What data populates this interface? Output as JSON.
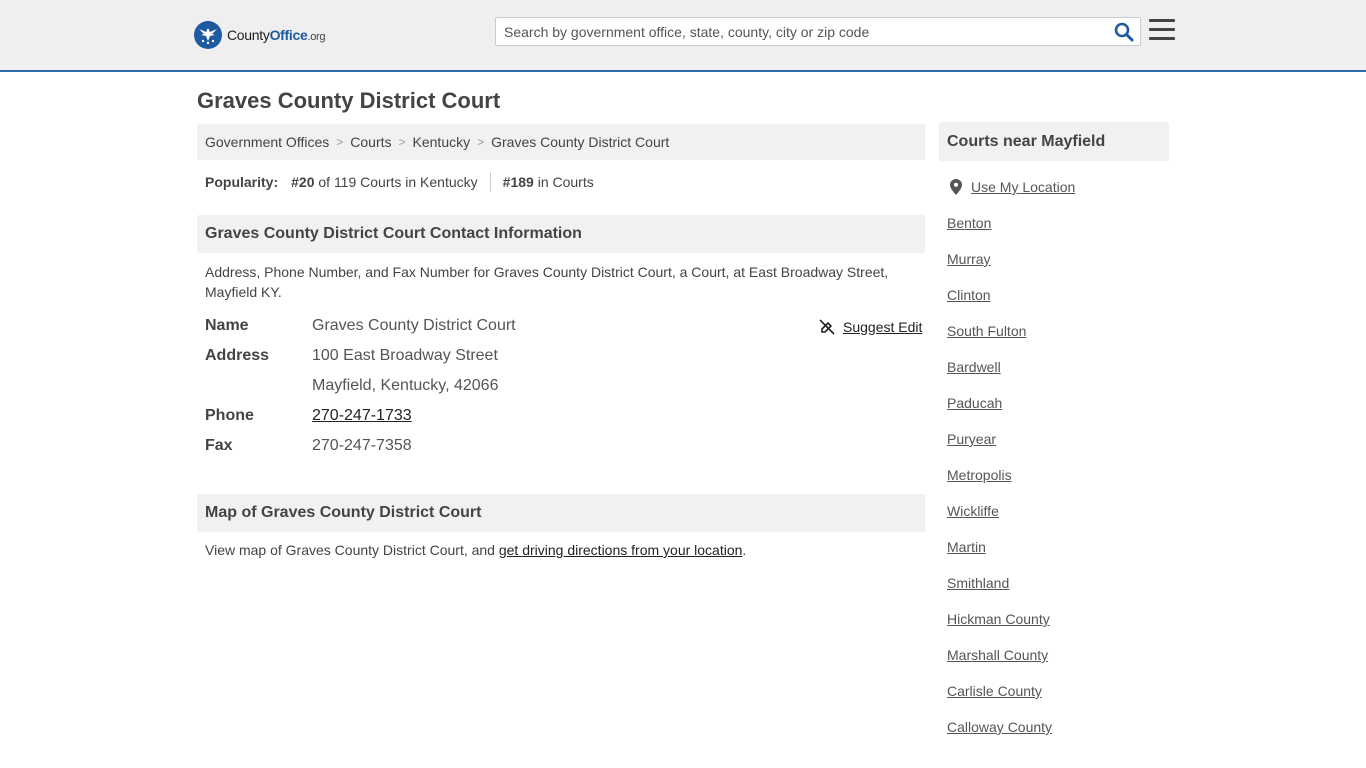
{
  "header": {
    "logo": {
      "name": "County",
      "bold": "Office",
      "suffix": ".org"
    },
    "search": {
      "placeholder": "Search by government office, state, county, city or zip code",
      "value": ""
    }
  },
  "page": {
    "title": "Graves County District Court"
  },
  "breadcrumb": [
    "Government Offices",
    "Courts",
    "Kentucky",
    "Graves County District Court"
  ],
  "popularity": {
    "label": "Popularity:",
    "state_rank": "#20",
    "state_text": " of 119 Courts in Kentucky",
    "national_rank": "#189",
    "national_text": " in Courts"
  },
  "contact": {
    "heading": "Graves County District Court Contact Information",
    "description": "Address, Phone Number, and Fax Number for Graves County District Court, a Court, at East Broadway Street, Mayfield KY.",
    "suggest_edit": "Suggest Edit",
    "rows": {
      "name": {
        "label": "Name",
        "value": "Graves County District Court"
      },
      "address": {
        "label": "Address",
        "line1": "100 East Broadway Street",
        "line2": "Mayfield, Kentucky, 42066"
      },
      "phone": {
        "label": "Phone",
        "value": "270-247-1733"
      },
      "fax": {
        "label": "Fax",
        "value": "270-247-7358"
      }
    }
  },
  "map": {
    "heading": "Map of Graves County District Court",
    "text_before": "View map of Graves County District Court, and ",
    "link": "get driving directions from your location",
    "text_after": "."
  },
  "sidebar": {
    "heading": "Courts near Mayfield",
    "use_location": "Use My Location",
    "items": [
      "Benton",
      "Murray",
      "Clinton",
      "South Fulton",
      "Bardwell",
      "Paducah",
      "Puryear",
      "Metropolis",
      "Wickliffe",
      "Martin",
      "Smithland",
      "Hickman County",
      "Marshall County",
      "Carlisle County",
      "Calloway County"
    ]
  },
  "colors": {
    "brand_blue": "#1e5aa0",
    "header_bg": "#efefef",
    "header_border": "#2e6ca6",
    "panel_bg": "#f1f1f1"
  },
  "icons": [
    "logo-eagle-icon",
    "search-icon",
    "hamburger-menu-icon",
    "suggest-edit-icon",
    "map-pin-icon"
  ]
}
